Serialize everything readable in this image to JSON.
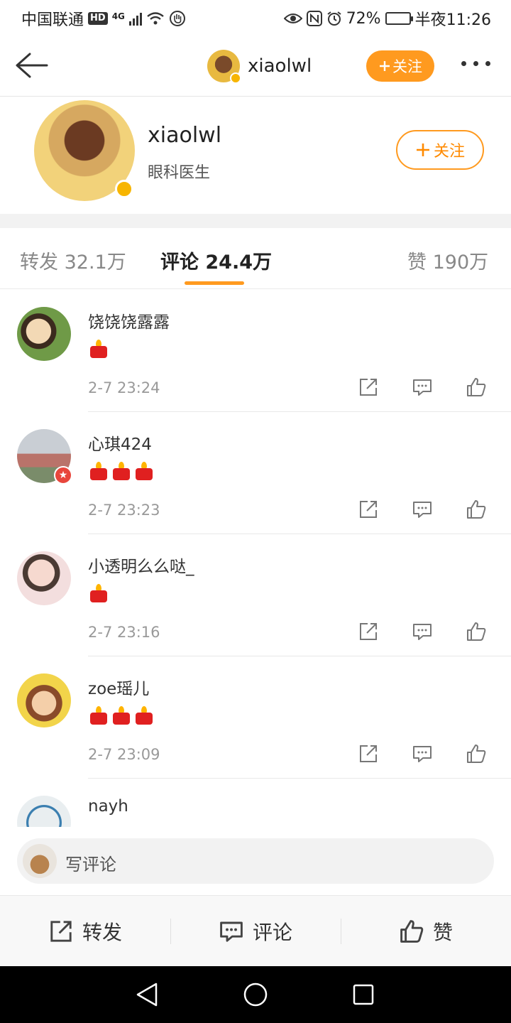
{
  "status_bar": {
    "carrier": "中国联通",
    "hd_badge": "HD",
    "network": "4G",
    "battery_percent": "72%",
    "battery_level": 0.72,
    "time": "半夜11:26"
  },
  "nav": {
    "username": "xiaolwl",
    "follow_label": "关注"
  },
  "profile": {
    "name": "xiaolwl",
    "description": "眼科医生",
    "follow_label": "关注"
  },
  "tabs": [
    {
      "label": "转发 32.1万"
    },
    {
      "label": "评论 24.4万",
      "active": true
    },
    {
      "label": "赞 190万"
    }
  ],
  "comments": [
    {
      "name": "饶饶饶露露",
      "candles": 1,
      "time": "2-7 23:24"
    },
    {
      "name": "心琪424",
      "candles": 3,
      "time": "2-7 23:23"
    },
    {
      "name": "小透明么么哒_",
      "candles": 1,
      "time": "2-7 23:16"
    },
    {
      "name": "zoe瑶儿",
      "candles": 3,
      "time": "2-7 23:09"
    },
    {
      "name": "nayh",
      "candles": 0,
      "time": ""
    }
  ],
  "input": {
    "placeholder": "写评论"
  },
  "toolbar": {
    "repost_label": "转发",
    "comment_label": "评论",
    "like_label": "赞"
  },
  "colors": {
    "accent_orange": "#ff9a1f",
    "verified_gold": "#f7b500",
    "candle_red": "#e02020"
  }
}
